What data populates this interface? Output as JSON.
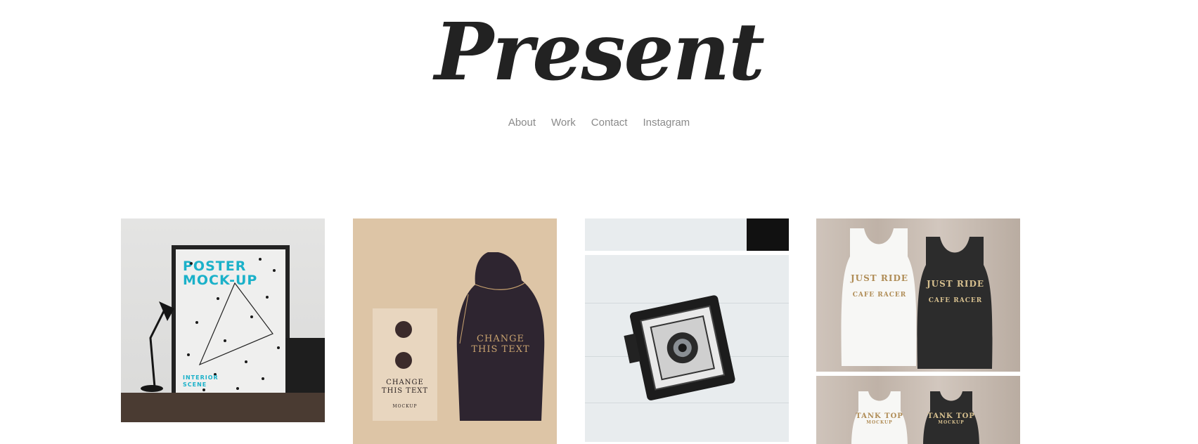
{
  "site": {
    "logo": "Present"
  },
  "nav": {
    "items": [
      "About",
      "Work",
      "Contact",
      "Instagram"
    ]
  },
  "gallery": {
    "tiles": [
      {
        "poster_title_line1": "POSTER",
        "poster_title_line2": "MOCK-UP",
        "poster_sub_line1": "INTERIOR",
        "poster_sub_line2": "SCENE"
      },
      {
        "bag_text_line1": "CHANGE",
        "bag_text_line2": "THIS TEXT",
        "envelope_text_line1": "CHANGE",
        "envelope_text_line2": "THIS TEXT",
        "envelope_label": "MOCKUP"
      },
      {},
      {
        "shirt_text_1": "JUST RIDE",
        "shirt_sub_1": "CAFE RACER",
        "shirt_text_2": "TANK TOP",
        "shirt_sub_2": "MOCKUP"
      }
    ]
  },
  "colors": {
    "accent": "#1bb1c9",
    "nav_text": "#8a8a8a",
    "logo": "#222222"
  }
}
